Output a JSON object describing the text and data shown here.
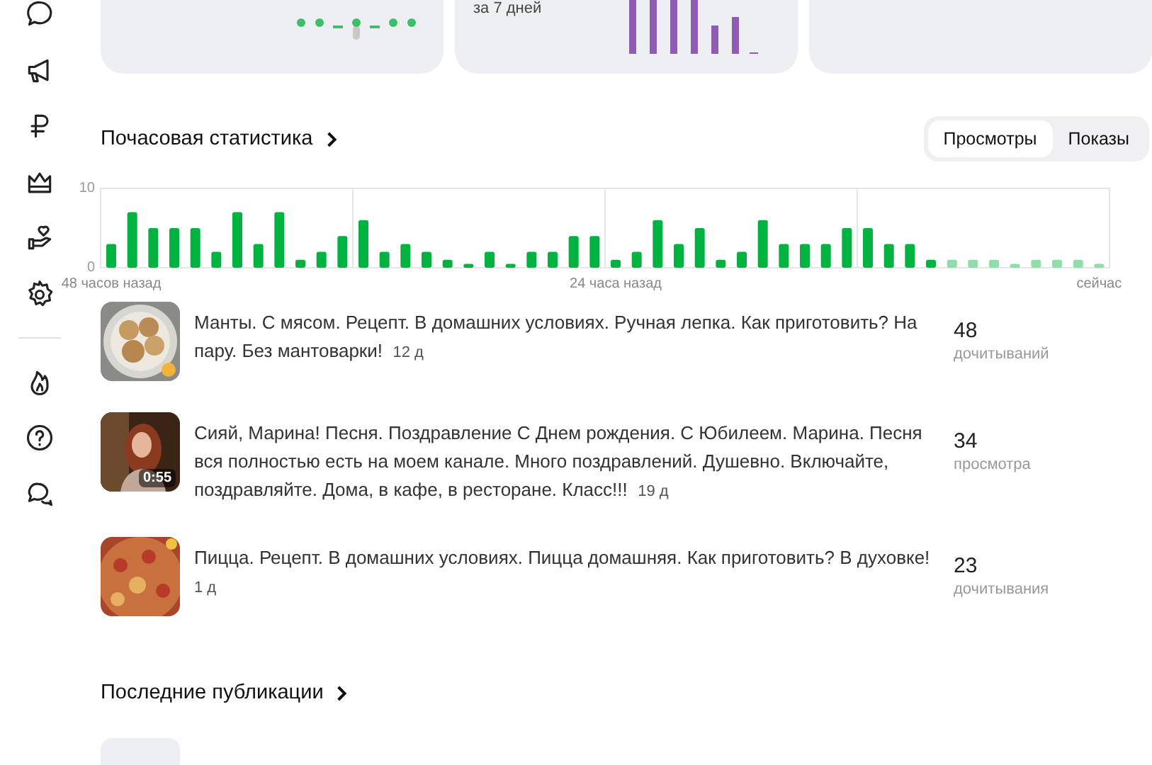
{
  "top_cards": [
    {
      "kind": "dots"
    },
    {
      "kind": "bars",
      "caption": "за 7 дней"
    },
    {
      "kind": "empty"
    }
  ],
  "hourly": {
    "title": "Почасовая статистика",
    "tabs": [
      {
        "label": "Просмотры",
        "selected": true
      },
      {
        "label": "Показы",
        "selected": false
      }
    ],
    "chart_data": {
      "type": "bar",
      "ylim": [
        0,
        10
      ],
      "yticks": [
        0,
        10
      ],
      "categories": [
        "48 часов назад",
        null,
        null,
        null,
        null,
        null,
        null,
        null,
        null,
        null,
        null,
        null,
        null,
        null,
        null,
        null,
        null,
        null,
        null,
        null,
        null,
        null,
        null,
        null,
        "24 часа назад",
        null,
        null,
        null,
        null,
        null,
        null,
        null,
        null,
        null,
        null,
        null,
        null,
        null,
        null,
        null,
        null,
        null,
        null,
        null,
        null,
        null,
        null,
        "сейчас"
      ],
      "series": [
        {
          "color": "#00b341",
          "values": [
            3,
            7,
            5,
            5,
            5,
            2,
            7,
            3,
            7,
            1,
            2,
            4,
            6,
            2,
            3,
            2,
            1,
            0.5,
            2,
            0.5,
            2,
            2,
            4,
            4,
            1,
            2,
            6,
            3,
            5,
            1,
            2,
            6,
            3,
            3,
            3,
            5,
            5,
            3,
            3,
            1,
            null,
            null,
            null,
            null,
            null,
            null,
            null,
            null
          ]
        },
        {
          "color": "#8fdda8",
          "values": [
            null,
            null,
            null,
            null,
            null,
            null,
            null,
            null,
            null,
            null,
            null,
            null,
            null,
            null,
            null,
            null,
            null,
            null,
            null,
            null,
            null,
            null,
            null,
            null,
            null,
            null,
            null,
            null,
            null,
            null,
            null,
            null,
            null,
            null,
            null,
            null,
            null,
            null,
            null,
            null,
            1,
            1,
            1,
            0.5,
            1,
            1,
            1,
            0.5
          ]
        }
      ]
    }
  },
  "publications": [
    {
      "kind": "picture",
      "title": "Манты. С мясом. Рецепт. В домашних условиях. Ручная лепка. Как приготовить? На пару. Без мантоварки!",
      "age": "12 д",
      "count": "48",
      "metric": "дочитываний"
    },
    {
      "kind": "picture",
      "title": "Сияй, Марина! Песня. Поздравление С Днем рождения. С Юбилеем. Марина. Песня вся полностью есть на моем канале. Много поздравлений. Душевно. Включайте, поздравляйте. Дома, в кафе, в ресторане. Класс!!!",
      "age": "19 д",
      "count": "34",
      "metric": "просмотра",
      "duration": "0:55"
    },
    {
      "kind": "picture",
      "title": "Пицца. Рецепт. В домашних условиях. Пицца домашняя. Как приготовить? В духовке!",
      "age": "1 д",
      "count": "23",
      "metric": "дочитывания"
    }
  ],
  "latest": {
    "title": "Последние публикации"
  }
}
